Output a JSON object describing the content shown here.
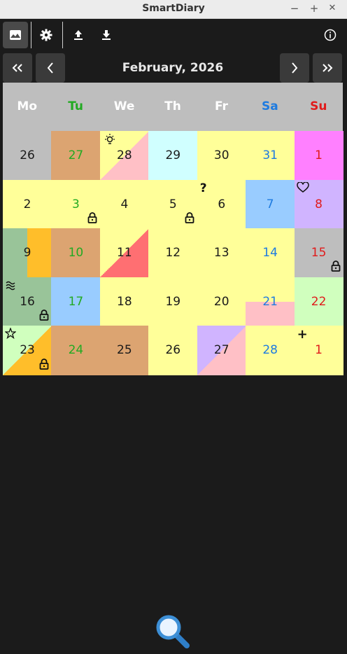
{
  "window": {
    "title": "SmartDiary",
    "minimize": "−",
    "maximize": "+",
    "close": "✕"
  },
  "nav": {
    "month_label": "February, 2026"
  },
  "weekdays": [
    {
      "label": "Mo",
      "color": "#ffffff"
    },
    {
      "label": "Tu",
      "color": "#22aa22"
    },
    {
      "label": "We",
      "color": "#ffffff"
    },
    {
      "label": "Th",
      "color": "#ffffff"
    },
    {
      "label": "Fr",
      "color": "#ffffff"
    },
    {
      "label": "Sa",
      "color": "#1e7be0"
    },
    {
      "label": "Su",
      "color": "#e01b1b"
    }
  ],
  "colors": {
    "yellow": "#ffff99",
    "gray": "#bebebe",
    "tan": "#dca471",
    "pink": "#ffc0c6",
    "cyan": "#d0ffff",
    "magenta": "#ff80ff",
    "lightblue": "#99ccff",
    "lavender": "#d0b4ff",
    "green": "#99c499",
    "orange": "#ffbe2a",
    "red": "#ff6f72",
    "lightgreen": "#d0ffbe",
    "text_black": "#1a1a1a",
    "text_green": "#22aa22",
    "text_blue": "#1e7be0",
    "text_red": "#e01b1b",
    "accent_search": "#3d8fd6"
  },
  "weeks": [
    [
      {
        "day": "26",
        "bg": "gray",
        "text": "black"
      },
      {
        "day": "27",
        "bg": "tan",
        "text": "green"
      },
      {
        "day": "28",
        "bg": "yellow",
        "tri": "pink",
        "text": "black",
        "icon": "lightbulb-icon"
      },
      {
        "day": "29",
        "bg": "cyan",
        "text": "black"
      },
      {
        "day": "30",
        "bg": "yellow",
        "text": "black"
      },
      {
        "day": "31",
        "bg": "yellow",
        "text": "blue"
      },
      {
        "day": "1",
        "bg": "magenta",
        "text": "red"
      }
    ],
    [
      {
        "day": "2",
        "bg": "yellow",
        "text": "black"
      },
      {
        "day": "3",
        "bg": "yellow",
        "text": "green",
        "lock": true
      },
      {
        "day": "4",
        "bg": "yellow",
        "text": "black"
      },
      {
        "day": "5",
        "bg": "yellow",
        "text": "black",
        "lock": true
      },
      {
        "day": "6",
        "bg": "yellow",
        "text": "black",
        "icon": "question-icon"
      },
      {
        "day": "7",
        "bg": "lightblue",
        "text": "blue"
      },
      {
        "day": "8",
        "bg": "lavender",
        "text": "red",
        "icon": "heart-icon"
      }
    ],
    [
      {
        "day": "9",
        "bg": "green",
        "right": "orange",
        "text": "black"
      },
      {
        "day": "10",
        "bg": "tan",
        "text": "green"
      },
      {
        "day": "11",
        "bg": "yellow",
        "tri": "red",
        "text": "black"
      },
      {
        "day": "12",
        "bg": "yellow",
        "text": "black"
      },
      {
        "day": "13",
        "bg": "yellow",
        "text": "black"
      },
      {
        "day": "14",
        "bg": "yellow",
        "text": "blue"
      },
      {
        "day": "15",
        "bg": "gray",
        "text": "red",
        "lock": true
      }
    ],
    [
      {
        "day": "16",
        "bg": "green",
        "text": "black",
        "lock": true,
        "icon": "wave-icon"
      },
      {
        "day": "17",
        "bg": "lightblue",
        "text": "green"
      },
      {
        "day": "18",
        "bg": "yellow",
        "text": "black"
      },
      {
        "day": "19",
        "bg": "yellow",
        "text": "black"
      },
      {
        "day": "20",
        "bg": "yellow",
        "text": "black"
      },
      {
        "day": "21",
        "bg": "yellow",
        "bottom": "pink",
        "text": "blue"
      },
      {
        "day": "22",
        "bg": "lightgreen",
        "text": "red"
      }
    ],
    [
      {
        "day": "23",
        "bg": "lightgreen",
        "tri": "orange",
        "text": "black",
        "lock": true,
        "icon": "star-icon"
      },
      {
        "day": "24",
        "bg": "tan",
        "text": "green"
      },
      {
        "day": "25",
        "bg": "tan",
        "text": "black"
      },
      {
        "day": "26",
        "bg": "yellow",
        "text": "black"
      },
      {
        "day": "27",
        "bg": "lavender",
        "tri": "pink",
        "text": "black"
      },
      {
        "day": "28",
        "bg": "yellow",
        "text": "blue"
      },
      {
        "day": "1",
        "bg": "yellow",
        "text": "red",
        "icon": "plus-icon"
      }
    ]
  ]
}
